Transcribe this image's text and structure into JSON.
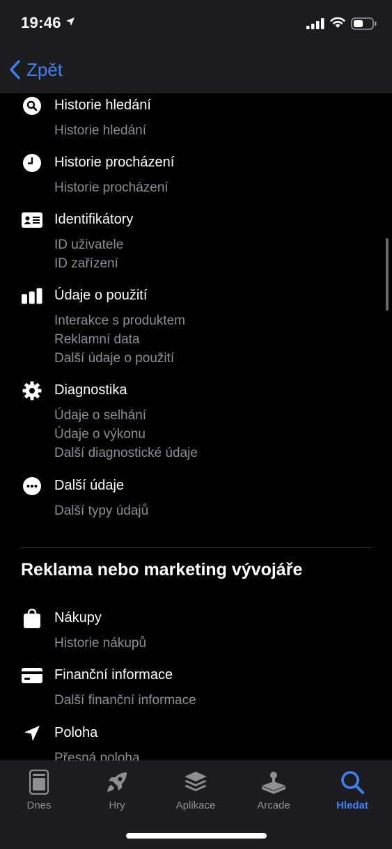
{
  "status_bar": {
    "time": "19:46"
  },
  "nav": {
    "back_label": "Zpět"
  },
  "categories_top": [
    {
      "icon": "search-icon",
      "title": "Historie hledání",
      "items": [
        "Historie hledání"
      ]
    },
    {
      "icon": "clock-icon",
      "title": "Historie procházení",
      "items": [
        "Historie procházení"
      ]
    },
    {
      "icon": "id-card-icon",
      "title": "Identifikátory",
      "items": [
        "ID uživatele",
        "ID zařízení"
      ]
    },
    {
      "icon": "bar-chart-icon",
      "title": "Údaje o použití",
      "items": [
        "Interakce s produktem",
        "Reklamní data",
        "Další údaje o použití"
      ]
    },
    {
      "icon": "gear-icon",
      "title": "Diagnostika",
      "items": [
        "Údaje o selhání",
        "Údaje o výkonu",
        "Další diagnostické údaje"
      ]
    },
    {
      "icon": "ellipsis-icon",
      "title": "Další údaje",
      "items": [
        "Další typy údajů"
      ]
    }
  ],
  "section": {
    "title": "Reklama nebo marketing vývojáře"
  },
  "categories_bottom": [
    {
      "icon": "bag-icon",
      "title": "Nákupy",
      "items": [
        "Historie nákupů"
      ]
    },
    {
      "icon": "credit-card-icon",
      "title": "Finanční informace",
      "items": [
        "Další finanční informace"
      ]
    },
    {
      "icon": "location-icon",
      "title": "Poloha",
      "items": [
        "Přesná poloha"
      ]
    }
  ],
  "tabs": [
    {
      "label": "Dnes",
      "icon": "today-icon",
      "active": false
    },
    {
      "label": "Hry",
      "icon": "rocket-icon",
      "active": false
    },
    {
      "label": "Aplikace",
      "icon": "apps-stack-icon",
      "active": false
    },
    {
      "label": "Arcade",
      "icon": "joystick-icon",
      "active": false
    },
    {
      "label": "Hledat",
      "icon": "search-icon",
      "active": true
    }
  ],
  "colors": {
    "accent": "#3b82f6",
    "secondary_text": "#8e8e93",
    "bar_bg": "#1c1c1e"
  }
}
